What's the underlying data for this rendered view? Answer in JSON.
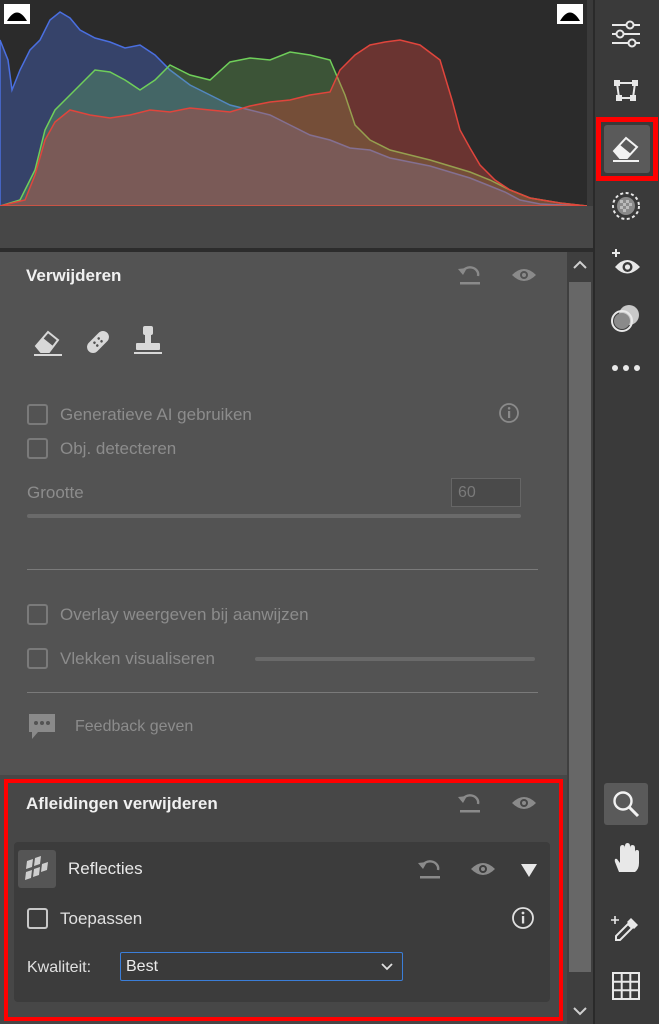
{
  "histogram": {
    "label": "histogram"
  },
  "remove_panel": {
    "title": "Verwijderen",
    "generative_ai_label": "Generatieve AI gebruiken",
    "detect_objects_label": "Obj. detecteren",
    "size_label": "Grootte",
    "size_value": "60",
    "overlay_label": "Overlay weergeven bij aanwijzen",
    "spots_label": "Vlekken visualiseren",
    "feedback_label": "Feedback geven"
  },
  "distraction_panel": {
    "title": "Afleidingen verwijderen",
    "reflections_label": "Reflecties",
    "apply_label": "Toepassen",
    "quality_label": "Kwaliteit:",
    "quality_value": "Best"
  },
  "colors": {
    "highlight": "#ff0000",
    "focus": "#3b7ed8",
    "panel": "#535353",
    "histogram_red": "#e0453c",
    "histogram_green": "#6fcf5a",
    "histogram_blue": "#4a6fe0"
  },
  "toolbar": {
    "icons": [
      "edit-sliders-icon",
      "crop-icon",
      "eraser-icon",
      "mask-icon",
      "red-eye-icon",
      "presets-icon",
      "more-icon",
      "zoom-icon",
      "hand-icon",
      "eyedropper-icon",
      "grid-icon"
    ]
  }
}
